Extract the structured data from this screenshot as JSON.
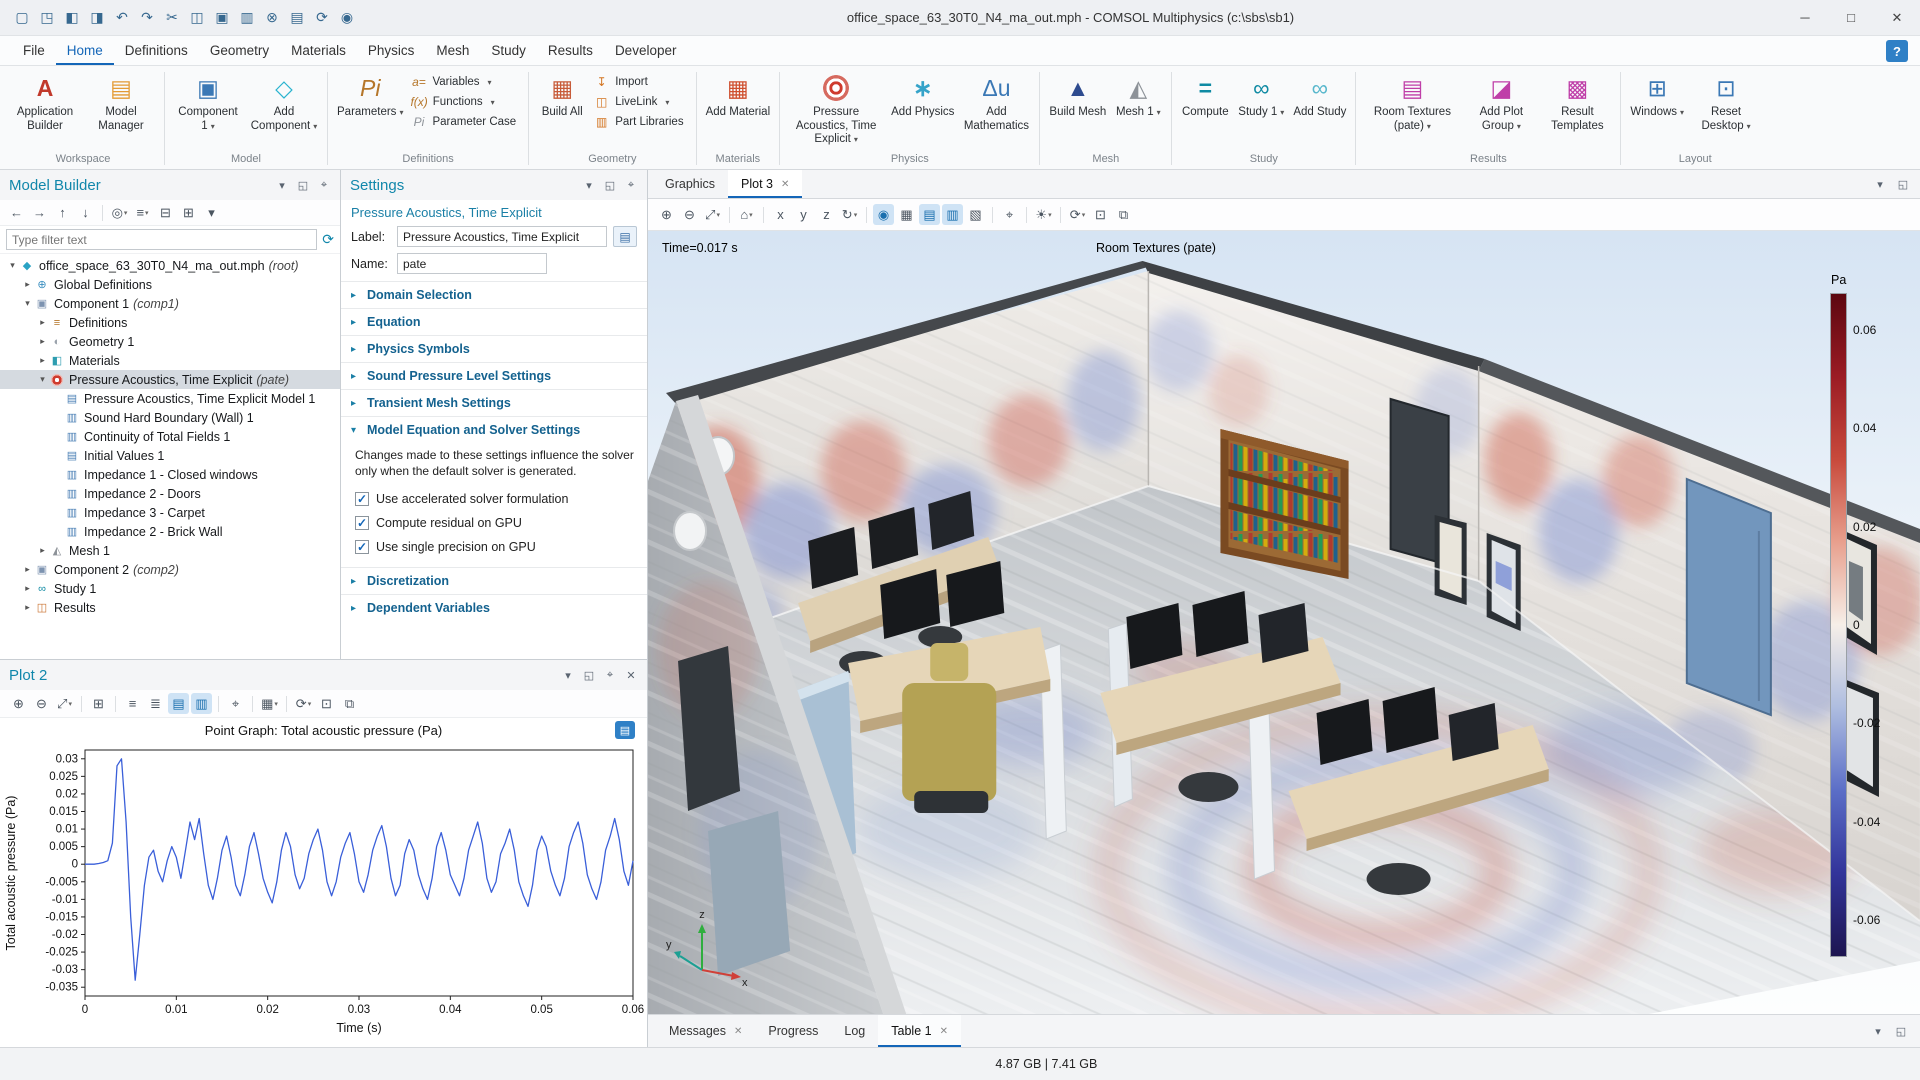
{
  "window": {
    "title": "office_space_63_30T0_N4_ma_out.mph - COMSOL Multiphysics (c:\\sbs\\sb1)",
    "status_memory": "4.87 GB | 7.41 GB"
  },
  "titlebar": {
    "quick_access": [
      {
        "name": "new-file",
        "glyph": "▢"
      },
      {
        "name": "open-file",
        "glyph": "◳"
      },
      {
        "name": "save",
        "glyph": "◧"
      },
      {
        "name": "save-as",
        "glyph": "◨"
      },
      {
        "name": "undo",
        "glyph": "↶"
      },
      {
        "name": "redo",
        "glyph": "↷"
      },
      {
        "name": "cut",
        "glyph": "✂"
      },
      {
        "name": "copy",
        "glyph": "◫"
      },
      {
        "name": "paste",
        "glyph": "▣"
      },
      {
        "name": "duplicate",
        "glyph": "▥"
      },
      {
        "name": "delete",
        "glyph": "⊗"
      },
      {
        "name": "compile-equations",
        "glyph": "▤"
      },
      {
        "name": "update-solution",
        "glyph": "⟳"
      },
      {
        "name": "plot",
        "glyph": "◉"
      }
    ],
    "window_controls": [
      {
        "name": "minimize",
        "glyph": "─"
      },
      {
        "name": "maximize",
        "glyph": "□"
      },
      {
        "name": "close",
        "glyph": "✕"
      }
    ]
  },
  "menubar": {
    "items": [
      {
        "label": "File"
      },
      {
        "label": "Home",
        "active": true
      },
      {
        "label": "Definitions"
      },
      {
        "label": "Geometry"
      },
      {
        "label": "Materials"
      },
      {
        "label": "Physics"
      },
      {
        "label": "Mesh"
      },
      {
        "label": "Study"
      },
      {
        "label": "Results"
      },
      {
        "label": "Developer"
      }
    ],
    "help_glyph": "?"
  },
  "ribbon": {
    "groups": [
      {
        "label": "Workspace",
        "buttons": [
          {
            "label": "Application Builder",
            "icon": "application-builder",
            "size": "large"
          },
          {
            "label": "Model Manager",
            "icon": "model-manager",
            "size": "large"
          }
        ]
      },
      {
        "label": "Model",
        "buttons": [
          {
            "label": "Component 1",
            "icon": "component",
            "size": "large",
            "dropdown": true
          },
          {
            "label": "Add Component",
            "icon": "add-component",
            "size": "large",
            "dropdown": true
          }
        ]
      },
      {
        "label": "Definitions",
        "buttons": [
          {
            "label": "Parameters",
            "icon": "parameters",
            "size": "large",
            "dropdown": true
          },
          {
            "label": "Variables",
            "icon": "variables",
            "size": "small",
            "dropdown": true
          },
          {
            "label": "Functions",
            "icon": "functions",
            "size": "small",
            "dropdown": true
          },
          {
            "label": "Parameter Case",
            "icon": "parameter-case",
            "size": "small"
          }
        ]
      },
      {
        "label": "Geometry",
        "buttons": [
          {
            "label": "Build All",
            "icon": "build-all",
            "size": "large"
          },
          {
            "label": "Import",
            "icon": "import",
            "size": "small"
          },
          {
            "label": "LiveLink",
            "icon": "livelink",
            "size": "small",
            "dropdown": true
          },
          {
            "label": "Part Libraries",
            "icon": "part-libraries",
            "size": "small"
          }
        ]
      },
      {
        "label": "Materials",
        "buttons": [
          {
            "label": "Add Material",
            "icon": "add-material",
            "size": "large"
          }
        ]
      },
      {
        "label": "Physics",
        "buttons": [
          {
            "label": "Pressure Acoustics, Time Explicit",
            "icon": "acoustics",
            "size": "large",
            "dropdown": true,
            "wide": true
          },
          {
            "label": "Add Physics",
            "icon": "add-physics",
            "size": "large"
          },
          {
            "label": "Add Mathematics",
            "icon": "add-mathematics",
            "size": "large"
          }
        ]
      },
      {
        "label": "Mesh",
        "buttons": [
          {
            "label": "Build Mesh",
            "icon": "build-mesh",
            "size": "large"
          },
          {
            "label": "Mesh 1",
            "icon": "mesh",
            "size": "large",
            "dropdown": true
          }
        ]
      },
      {
        "label": "Study",
        "buttons": [
          {
            "label": "Compute",
            "icon": "compute",
            "size": "large"
          },
          {
            "label": "Study 1",
            "icon": "study",
            "size": "large",
            "dropdown": true
          },
          {
            "label": "Add Study",
            "icon": "add-study",
            "size": "large"
          }
        ]
      },
      {
        "label": "Results",
        "buttons": [
          {
            "label": "Room Textures (pate)",
            "icon": "room-textures",
            "size": "large",
            "dropdown": true,
            "wide": true
          },
          {
            "label": "Add Plot Group",
            "icon": "add-plot-group",
            "size": "large",
            "dropdown": true
          },
          {
            "label": "Result Templates",
            "icon": "result-templates",
            "size": "large"
          }
        ]
      },
      {
        "label": "Layout",
        "buttons": [
          {
            "label": "Windows",
            "icon": "windows",
            "size": "large",
            "dropdown": true
          },
          {
            "label": "Reset Desktop",
            "icon": "reset-desktop",
            "size": "large",
            "dropdown": true
          }
        ]
      }
    ]
  },
  "model_builder": {
    "title": "Model Builder",
    "filter_placeholder": "Type filter text",
    "header_icons": [
      {
        "name": "panel-menu",
        "glyph": "▾"
      },
      {
        "name": "float-panel",
        "glyph": "◱"
      },
      {
        "name": "pin-panel",
        "glyph": "⌖"
      }
    ],
    "toolbar": [
      {
        "name": "go-back",
        "glyph": "←"
      },
      {
        "name": "go-forward",
        "glyph": "→"
      },
      {
        "name": "move-up",
        "glyph": "↑"
      },
      {
        "name": "move-down",
        "glyph": "↓"
      },
      {
        "sep": true
      },
      {
        "name": "show",
        "glyph": "◎",
        "dropdown": true
      },
      {
        "name": "model-tree-node-text",
        "glyph": "≡",
        "dropdown": true
      },
      {
        "name": "collapse-all",
        "glyph": "⊟"
      },
      {
        "name": "expand-all",
        "glyph": "⊞"
      },
      {
        "name": "more-options",
        "glyph": "▾"
      }
    ],
    "tree": [
      {
        "depth": 0,
        "expand": "open",
        "icon": "model-root",
        "label": "office_space_63_30T0_N4_ma_out.mph",
        "suffix": "(root)"
      },
      {
        "depth": 1,
        "expand": "closed",
        "icon": "global-definitions",
        "label": "Global Definitions"
      },
      {
        "depth": 1,
        "expand": "open",
        "icon": "component",
        "label": "Component 1",
        "suffix": "(comp1)"
      },
      {
        "depth": 2,
        "expand": "closed",
        "icon": "definitions",
        "label": "Definitions"
      },
      {
        "depth": 2,
        "expand": "closed",
        "icon": "geometry",
        "label": "Geometry 1"
      },
      {
        "depth": 2,
        "expand": "closed",
        "icon": "materials",
        "label": "Materials"
      },
      {
        "depth": 2,
        "expand": "open",
        "icon": "acoustics",
        "label": "Pressure Acoustics, Time Explicit",
        "suffix": "(pate)",
        "selected": true
      },
      {
        "depth": 3,
        "icon": "feature",
        "label": "Pressure Acoustics, Time Explicit Model 1"
      },
      {
        "depth": 3,
        "icon": "feature-boundary",
        "label": "Sound Hard Boundary (Wall) 1"
      },
      {
        "depth": 3,
        "icon": "feature-boundary",
        "label": "Continuity of Total Fields 1"
      },
      {
        "depth": 3,
        "icon": "feature",
        "label": "Initial Values 1"
      },
      {
        "depth": 3,
        "icon": "feature-boundary",
        "label": "Impedance 1 - Closed windows"
      },
      {
        "depth": 3,
        "icon": "feature-boundary",
        "label": "Impedance 2 - Doors"
      },
      {
        "depth": 3,
        "icon": "feature-boundary",
        "label": "Impedance 3 - Carpet"
      },
      {
        "depth": 3,
        "icon": "feature-boundary",
        "label": "Impedance 2 - Brick Wall"
      },
      {
        "depth": 2,
        "expand": "closed",
        "icon": "mesh",
        "label": "Mesh 1"
      },
      {
        "depth": 1,
        "expand": "closed",
        "icon": "component",
        "label": "Component 2",
        "suffix": "(comp2)"
      },
      {
        "depth": 1,
        "expand": "closed",
        "icon": "study",
        "label": "Study 1"
      },
      {
        "depth": 1,
        "expand": "closed",
        "icon": "results",
        "label": "Results"
      }
    ]
  },
  "settings": {
    "title": "Settings",
    "subtitle": "Pressure Acoustics, Time Explicit",
    "header_icons": [
      {
        "name": "panel-menu",
        "glyph": "▾"
      },
      {
        "name": "float-panel",
        "glyph": "◱"
      },
      {
        "name": "pin-panel",
        "glyph": "⌖"
      }
    ],
    "label_field": {
      "label": "Label:",
      "value": "Pressure Acoustics, Time Explicit",
      "button_glyph": "▤"
    },
    "name_field": {
      "label": "Name:",
      "value": "pate"
    },
    "sections": [
      {
        "title": "Domain Selection"
      },
      {
        "title": "Equation"
      },
      {
        "title": "Physics Symbols"
      },
      {
        "title": "Sound Pressure Level Settings"
      },
      {
        "title": "Transient Mesh Settings"
      },
      {
        "title": "Model Equation and Solver Settings",
        "expanded": true,
        "note": "Changes made to these settings influence the solver only when the default solver is generated.",
        "checkboxes": [
          {
            "label": "Use accelerated solver formulation",
            "checked": true
          },
          {
            "label": "Compute residual on GPU",
            "checked": true
          },
          {
            "label": "Use single precision on GPU",
            "checked": true
          }
        ]
      },
      {
        "title": "Discretization"
      },
      {
        "title": "Dependent Variables"
      }
    ]
  },
  "plot2": {
    "title": "Plot 2",
    "window_button_glyph": "▤",
    "header_icons": [
      {
        "name": "panel-menu",
        "glyph": "▾"
      },
      {
        "name": "float-panel",
        "glyph": "◱"
      },
      {
        "name": "pin-panel",
        "glyph": "⌖"
      },
      {
        "name": "close-panel",
        "glyph": "✕"
      }
    ],
    "toolbar": [
      {
        "name": "zoom-in",
        "glyph": "⊕"
      },
      {
        "name": "zoom-out",
        "glyph": "⊖"
      },
      {
        "name": "zoom-extents",
        "glyph": "⤢",
        "dropdown": true
      },
      {
        "sep": true
      },
      {
        "name": "axis-extents",
        "glyph": "⊞"
      },
      {
        "sep": true
      },
      {
        "name": "x-log-scale",
        "glyph": "≡"
      },
      {
        "name": "y-log-scale",
        "glyph": "≣"
      },
      {
        "name": "show-grid",
        "glyph": "▤",
        "active": true
      },
      {
        "name": "show-legends",
        "glyph": "▥",
        "active": true
      },
      {
        "sep": true
      },
      {
        "name": "lock-axes",
        "glyph": "⌖"
      },
      {
        "sep": true
      },
      {
        "name": "image-export",
        "glyph": "▦",
        "dropdown": true
      },
      {
        "sep": true
      },
      {
        "name": "update-plot",
        "glyph": "⟳",
        "dropdown": true
      },
      {
        "name": "snapshot",
        "glyph": "⊡"
      },
      {
        "name": "print",
        "glyph": "⧉"
      }
    ],
    "chart_data": {
      "type": "line",
      "title": "Point Graph: Total acoustic pressure (Pa)",
      "xlabel": "Time (s)",
      "ylabel": "Total acoustic pressure (Pa)",
      "series_name": "Total acoustic pressure",
      "xlim": [
        0,
        0.06
      ],
      "ylim": [
        -0.0375,
        0.0325
      ],
      "xticks": [
        0,
        0.01,
        0.02,
        0.03,
        0.04,
        0.05,
        0.06
      ],
      "yticks": [
        0.03,
        0.025,
        0.02,
        0.015,
        0.01,
        0.005,
        0,
        -0.005,
        -0.01,
        -0.015,
        -0.02,
        -0.025,
        -0.03,
        -0.035
      ],
      "grid": false,
      "legend": "none",
      "line_color": "#3a5fd9",
      "x_start": 0,
      "x_step": 0.0005,
      "y": [
        0,
        0,
        0,
        0.0002,
        0.0005,
        0.001,
        0.006,
        0.028,
        0.03,
        0.012,
        -0.015,
        -0.033,
        -0.02,
        -0.006,
        0.002,
        0.004,
        -0.002,
        -0.005,
        0.001,
        0.005,
        0.002,
        -0.004,
        0.004,
        0.012,
        0.007,
        0.013,
        0.003,
        -0.006,
        -0.01,
        -0.004,
        0.004,
        0.008,
        0.002,
        -0.006,
        -0.009,
        -0.003,
        0.005,
        0.009,
        0.003,
        -0.004,
        -0.008,
        -0.011,
        -0.005,
        0.004,
        0.009,
        0.005,
        -0.003,
        -0.007,
        -0.004,
        0.003,
        0.007,
        0.01,
        0.004,
        -0.005,
        -0.009,
        -0.005,
        0.002,
        0.006,
        0.009,
        0.003,
        -0.005,
        -0.008,
        -0.003,
        0.004,
        0.008,
        0.011,
        0.005,
        -0.004,
        -0.009,
        -0.006,
        0.003,
        0.007,
        0.004,
        -0.003,
        -0.007,
        -0.01,
        -0.004,
        0.005,
        0.009,
        0.004,
        -0.003,
        -0.006,
        -0.009,
        -0.004,
        0.004,
        0.008,
        0.012,
        0.006,
        -0.004,
        -0.008,
        -0.005,
        0.003,
        0.006,
        0.01,
        0.004,
        -0.005,
        -0.009,
        -0.012,
        -0.006,
        0.004,
        0.008,
        0.005,
        -0.002,
        -0.006,
        -0.009,
        -0.004,
        0.005,
        0.009,
        0.012,
        0.006,
        -0.003,
        -0.007,
        -0.01,
        -0.005,
        0.004,
        0.008,
        0.013,
        0.007,
        -0.002,
        -0.006,
        0.001
      ]
    }
  },
  "graphics": {
    "tabs": [
      {
        "label": "Graphics"
      },
      {
        "label": "Plot 3",
        "active": true,
        "closable": true
      }
    ],
    "header_icons": [
      {
        "name": "panel-menu",
        "glyph": "▾"
      },
      {
        "name": "float-panel",
        "glyph": "◱"
      }
    ],
    "toolbar": [
      {
        "name": "zoom-in",
        "glyph": "⊕"
      },
      {
        "name": "zoom-out",
        "glyph": "⊖"
      },
      {
        "name": "zoom-extents",
        "glyph": "⤢",
        "dropdown": true
      },
      {
        "sep": true
      },
      {
        "name": "go-to-default-view",
        "glyph": "⌂",
        "dropdown": true
      },
      {
        "sep": true
      },
      {
        "name": "view-along-x",
        "glyph": "x"
      },
      {
        "name": "view-along-y",
        "glyph": "y"
      },
      {
        "name": "view-along-z",
        "glyph": "z"
      },
      {
        "name": "rotate-view",
        "glyph": "↻",
        "dropdown": true
      },
      {
        "sep": true
      },
      {
        "name": "play-sound",
        "glyph": "◉",
        "active": true
      },
      {
        "name": "show-grid",
        "glyph": "▦"
      },
      {
        "name": "show-material-color",
        "glyph": "▤",
        "active": true
      },
      {
        "name": "show-selection-colors",
        "glyph": "▥",
        "active": true
      },
      {
        "name": "transparency",
        "glyph": "▧"
      },
      {
        "sep": true
      },
      {
        "name": "lock-view",
        "glyph": "⌖"
      },
      {
        "sep": true
      },
      {
        "name": "scene-light",
        "glyph": "☀",
        "dropdown": true
      },
      {
        "sep": true
      },
      {
        "name": "update-plot",
        "glyph": "⟳",
        "dropdown": true
      },
      {
        "name": "snapshot",
        "glyph": "⊡"
      },
      {
        "name": "print",
        "glyph": "⧉"
      }
    ],
    "time_label": "Time=0.017 s",
    "plot_title": "Room Textures (pate)",
    "colorbar": {
      "unit": "Pa",
      "vmax": 0.0675,
      "vmin": -0.0675,
      "ticks": [
        0.06,
        0.04,
        0.02,
        0,
        -0.02,
        -0.04,
        -0.06
      ],
      "colors": [
        "#5c0710",
        "#9b1c24",
        "#c84a3c",
        "#e8a08e",
        "#f6efe8",
        "#aebde0",
        "#5b6ec7",
        "#32349a",
        "#1d1550"
      ]
    },
    "axis_triad": {
      "x": "x",
      "y": "y",
      "z": "z"
    }
  },
  "bottom_tabs": {
    "tabs": [
      {
        "label": "Messages",
        "closable": true
      },
      {
        "label": "Progress"
      },
      {
        "label": "Log"
      },
      {
        "label": "Table 1",
        "active": true,
        "closable": true
      }
    ],
    "right_icons": [
      {
        "name": "panel-menu",
        "glyph": "▾"
      },
      {
        "name": "float-panel",
        "glyph": "◱"
      }
    ]
  }
}
